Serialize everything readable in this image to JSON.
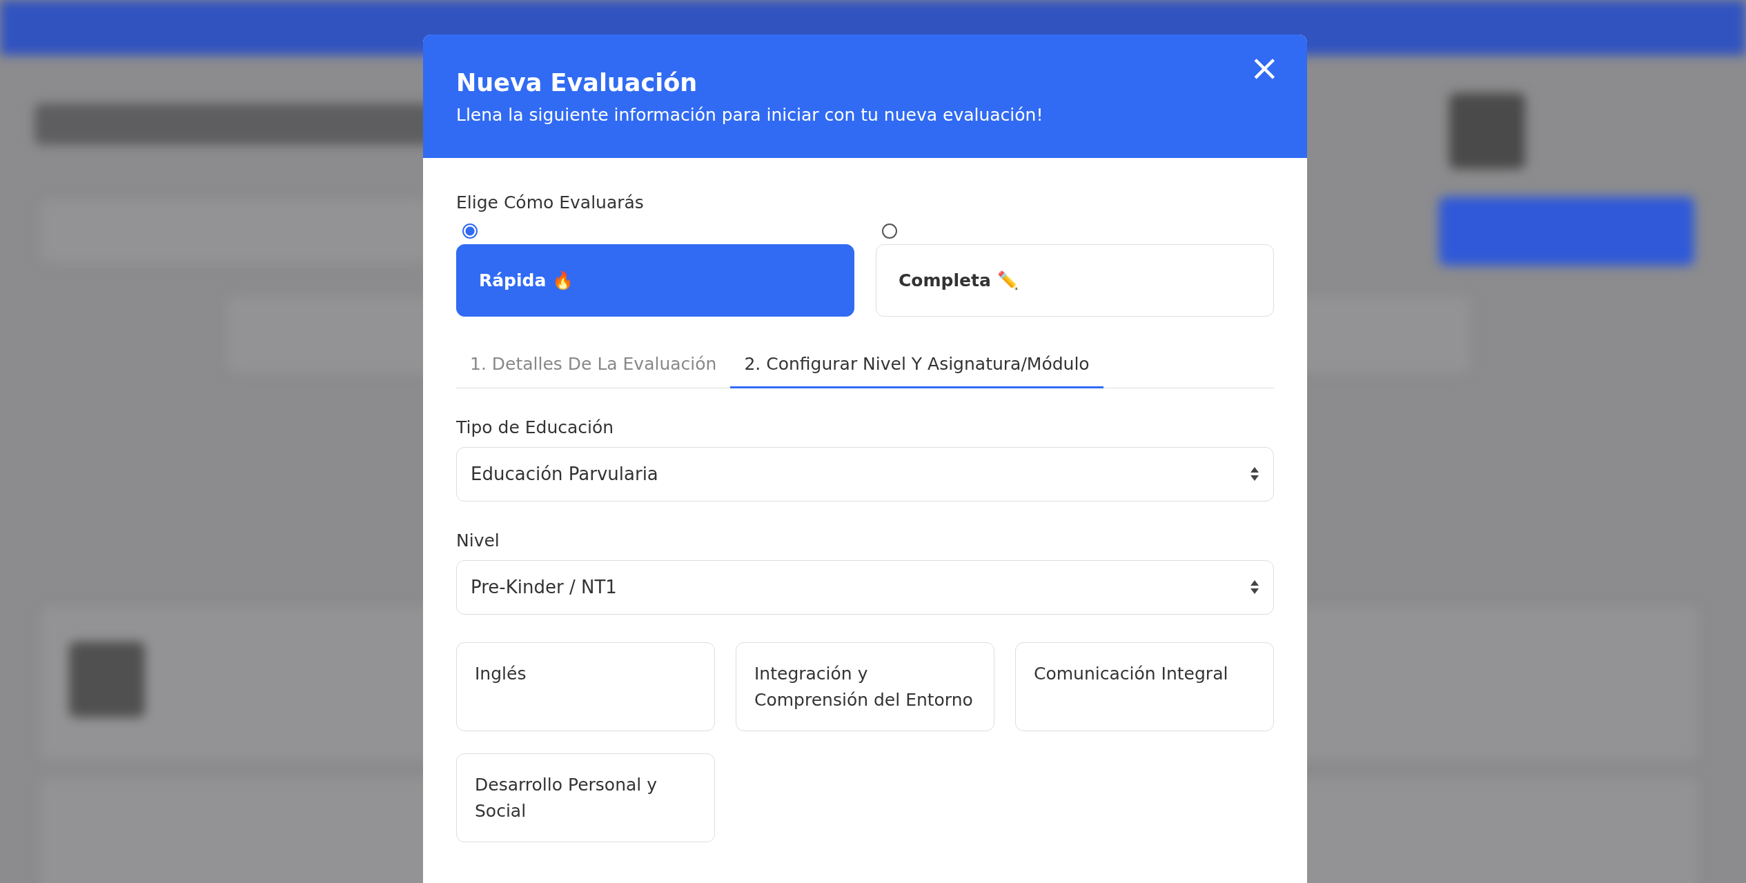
{
  "modal": {
    "title": "Nueva Evaluación",
    "subtitle": "Llena la siguiente información para iniciar con tu nueva evaluación!",
    "close_icon": "×"
  },
  "method": {
    "label": "Elige Cómo Evaluarás",
    "options": [
      {
        "label": "Rápida 🔥",
        "selected": true
      },
      {
        "label": "Completa ✏️",
        "selected": false
      }
    ]
  },
  "tabs": [
    {
      "label": "1. Detalles De La Evaluación",
      "selected": false
    },
    {
      "label": "2. Configurar Nivel Y Asignatura/Módulo",
      "selected": true
    }
  ],
  "fields": [
    {
      "label": "Tipo de Educación",
      "value": "Educación Parvularia"
    },
    {
      "label": "Nivel",
      "value": "Pre-Kinder / NT1"
    }
  ],
  "subjects": [
    {
      "label": "Inglés",
      "selected": false
    },
    {
      "label": "Integración y Comprensión del Entorno",
      "selected": false
    },
    {
      "label": "Comunicación Integral",
      "selected": false
    },
    {
      "label": "Desarrollo Personal y Social",
      "selected": false
    }
  ]
}
